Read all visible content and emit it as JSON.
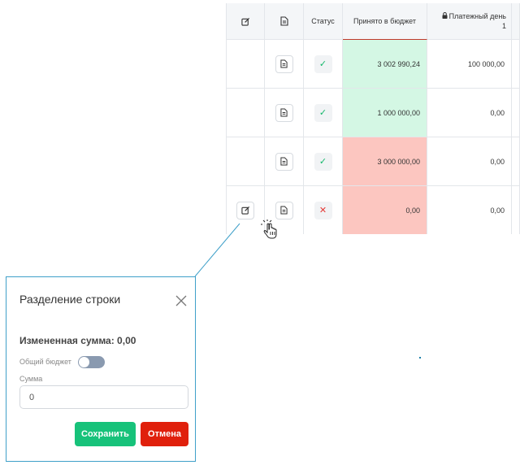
{
  "table": {
    "headers": {
      "edit_icon": "edit-icon",
      "doc_icon": "document-icon",
      "status": "Статус",
      "accepted": "Принято в бюджет",
      "payment_day": "Платежный день",
      "payment_day_num": "1"
    },
    "rows": [
      {
        "status": "ok",
        "accepted": "3 002 990,24",
        "payment": "100 000,00",
        "color": "green",
        "editable": false
      },
      {
        "status": "ok",
        "accepted": "1 000 000,00",
        "payment": "0,00",
        "color": "green",
        "editable": false
      },
      {
        "status": "ok",
        "accepted": "3 000 000,00",
        "payment": "0,00",
        "color": "red",
        "editable": false
      },
      {
        "status": "bad",
        "accepted": "0,00",
        "payment": "0,00",
        "color": "red",
        "editable": true
      }
    ]
  },
  "popup": {
    "title": "Разделение строки",
    "changed_amount": "Измененная сумма: 0,00",
    "budget_label": "Общий бюджет",
    "budget_toggle_on": false,
    "sum_label": "Сумма",
    "sum_value": "0",
    "save_label": "Сохранить",
    "cancel_label": "Отмена"
  },
  "colors": {
    "accent_green": "#17c27a",
    "cancel_red": "#e0200c",
    "row_green": "#d4f7e4",
    "row_red": "#fcc6c0",
    "popup_border": "#3fa0c9"
  }
}
